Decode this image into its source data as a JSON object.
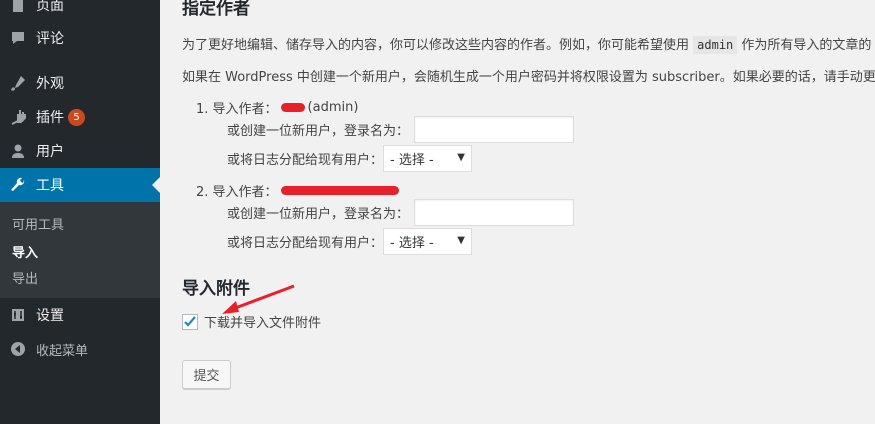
{
  "sidebar": {
    "items": [
      {
        "label": "页面",
        "icon": "pages-icon"
      },
      {
        "label": "评论",
        "icon": "comments-icon"
      },
      {
        "label": "外观",
        "icon": "appearance-icon"
      },
      {
        "label": "插件",
        "icon": "plugins-icon",
        "badge": "5"
      },
      {
        "label": "用户",
        "icon": "users-icon"
      },
      {
        "label": "工具",
        "icon": "tools-icon",
        "active": true
      },
      {
        "label": "设置",
        "icon": "settings-icon"
      },
      {
        "label": "收起菜单",
        "icon": "collapse-icon"
      }
    ],
    "submenu": [
      {
        "label": "可用工具"
      },
      {
        "label": "导入",
        "current": true
      },
      {
        "label": "导出"
      }
    ]
  },
  "main": {
    "title": "指定作者",
    "para1_before": "为了更好地编辑、储存导入的内容，你可以修改这些内容的作者。例如，你可能希望使用",
    "para1_code": "admin",
    "para1_after": "作为所有导入的文章的",
    "para2": "如果在 WordPress 中创建一个新用户，会随机生成一个用户密码并将权限设置为 subscriber。如果必要的话，请手动更改用",
    "authors": [
      {
        "label": "1. 导入作者：",
        "suffix": "(admin)",
        "create_label": "或创建一位新用户，登录名为：",
        "assign_label": "或将日志分配给现有用户：",
        "select_value": "- 选择 -"
      },
      {
        "label": "2. 导入作者：",
        "suffix": "",
        "create_label": "或创建一位新用户，登录名为：",
        "assign_label": "或将日志分配给现有用户：",
        "select_value": "- 选择 -"
      }
    ],
    "attachments_title": "导入附件",
    "download_label": "下载并导入文件附件",
    "download_checked": true,
    "submit_label": "提交"
  },
  "colors": {
    "sidebar_bg": "#23282d",
    "active_bg": "#0073aa",
    "badge_bg": "#ca4a1f",
    "redaction": "#e8202a"
  }
}
